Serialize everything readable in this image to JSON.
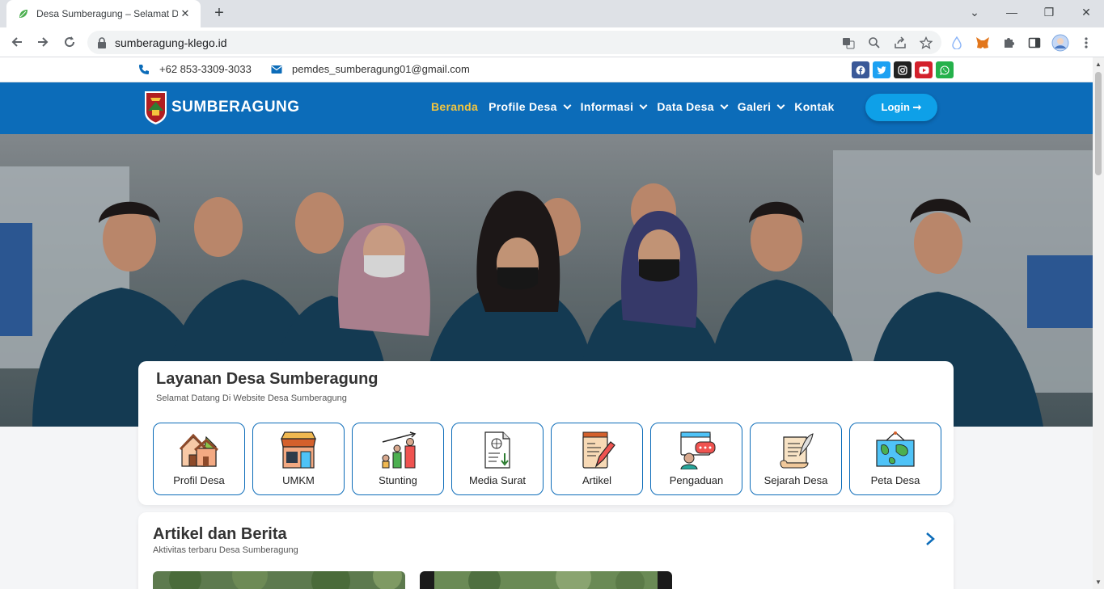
{
  "browser": {
    "tab_title": "Desa Sumberagung – Selamat Datang",
    "url": "sumberagung-klego.id"
  },
  "contact": {
    "phone": "+62 853-3309-3033",
    "email": "pemdes_sumberagung01@gmail.com"
  },
  "socials": [
    {
      "icon": "facebook-icon",
      "color": "#3b5998"
    },
    {
      "icon": "twitter-icon",
      "color": "#1da1f2"
    },
    {
      "icon": "instagram-icon",
      "color": "#222222"
    },
    {
      "icon": "youtube-icon",
      "color": "#d3212c"
    },
    {
      "icon": "whatsapp-icon",
      "color": "#25b14b"
    }
  ],
  "navbar": {
    "brand": "SUMBERAGUNG",
    "menu": [
      {
        "label": "Beranda",
        "active": true,
        "dropdown": false
      },
      {
        "label": "Profile Desa",
        "active": false,
        "dropdown": true
      },
      {
        "label": "Informasi",
        "active": false,
        "dropdown": true
      },
      {
        "label": "Data Desa",
        "active": false,
        "dropdown": true
      },
      {
        "label": "Galeri",
        "active": false,
        "dropdown": true
      },
      {
        "label": "Kontak",
        "active": false,
        "dropdown": false
      }
    ],
    "login": "Login ➞"
  },
  "services": {
    "title": "Layanan Desa Sumberagung",
    "subtitle": "Selamat Datang Di Website Desa Sumberagung",
    "items": [
      {
        "label": "Profil Desa",
        "icon": "village-houses-icon"
      },
      {
        "label": "UMKM",
        "icon": "shop-icon"
      },
      {
        "label": "Stunting",
        "icon": "growth-family-icon"
      },
      {
        "label": "Media Surat",
        "icon": "document-download-icon"
      },
      {
        "label": "Artikel",
        "icon": "notepad-pen-icon"
      },
      {
        "label": "Pengaduan",
        "icon": "complaint-chat-icon"
      },
      {
        "label": "Sejarah Desa",
        "icon": "scroll-quill-icon"
      },
      {
        "label": "Peta Desa",
        "icon": "map-icon"
      }
    ]
  },
  "articles": {
    "title": "Artikel dan Berita",
    "subtitle": "Aktivitas terbaru Desa Sumberagung"
  },
  "colors": {
    "brand_blue": "#0c6cb9",
    "active_menu": "#f3c53e",
    "login_button": "#0ea0e8"
  }
}
